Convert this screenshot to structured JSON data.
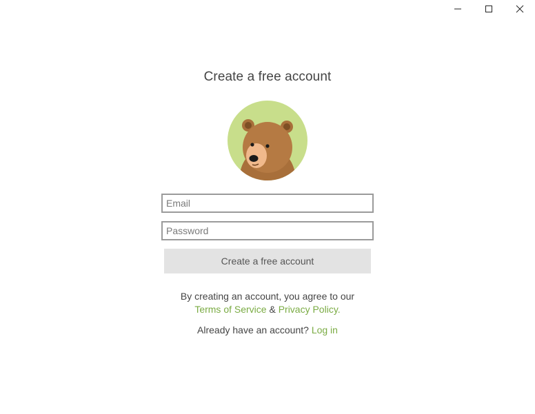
{
  "window": {
    "controls": [
      {
        "name": "minimize",
        "icon": "minimize-icon"
      },
      {
        "name": "maximize",
        "icon": "maximize-icon"
      },
      {
        "name": "close",
        "icon": "close-icon"
      }
    ]
  },
  "signup": {
    "title": "Create a free account",
    "avatar_icon": "bear-avatar-icon",
    "email_placeholder": "Email",
    "email_value": "",
    "password_placeholder": "Password",
    "password_value": "",
    "submit_label": "Create a free account",
    "terms_prefix": "By creating an account, you agree to our",
    "terms_link": "Terms of Service",
    "terms_and": "&",
    "privacy_link": "Privacy Policy.",
    "login_prompt": "Already have an account?",
    "login_link": "Log in"
  },
  "colors": {
    "accent_link": "#7aab43",
    "avatar_bg": "#c8de8b",
    "button_bg": "#e3e3e3"
  }
}
